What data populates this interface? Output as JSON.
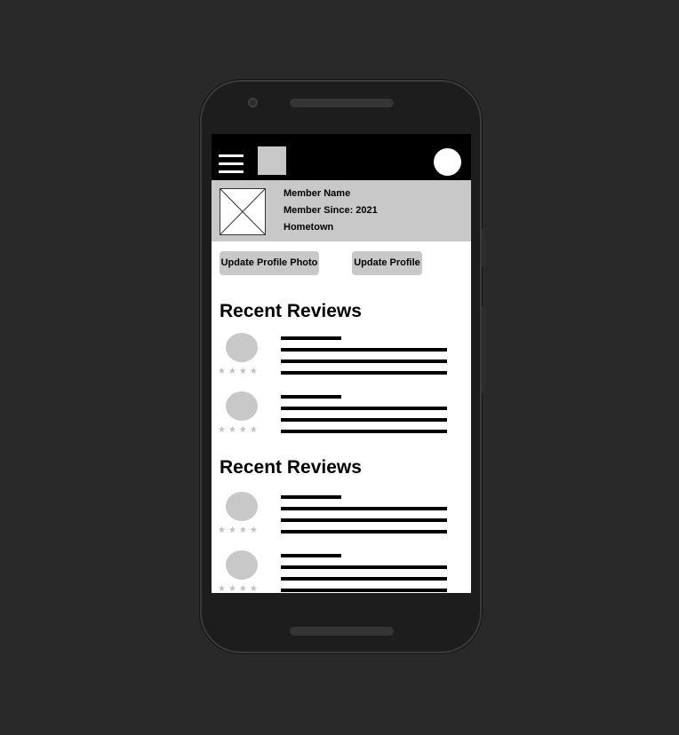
{
  "profile": {
    "name": "Member Name",
    "member_since": "Member Since: 2021",
    "hometown": "Hometown"
  },
  "actions": {
    "update_photo_label": "Update Profile Photo",
    "update_profile_label": "Update Profile"
  },
  "sections": [
    {
      "title": "Recent Reviews"
    },
    {
      "title": "Recent Reviews"
    }
  ],
  "review_stars": "★★★★",
  "colors": {
    "background": "#292929",
    "phone": "#1d1d1d",
    "topbar": "#000000",
    "placeholder": "#c8c8c8"
  },
  "icons": {
    "menu": "hamburger-icon",
    "logo": "logo-placeholder",
    "avatar": "avatar-icon",
    "photo": "image-placeholder-icon",
    "star": "star-icon"
  }
}
